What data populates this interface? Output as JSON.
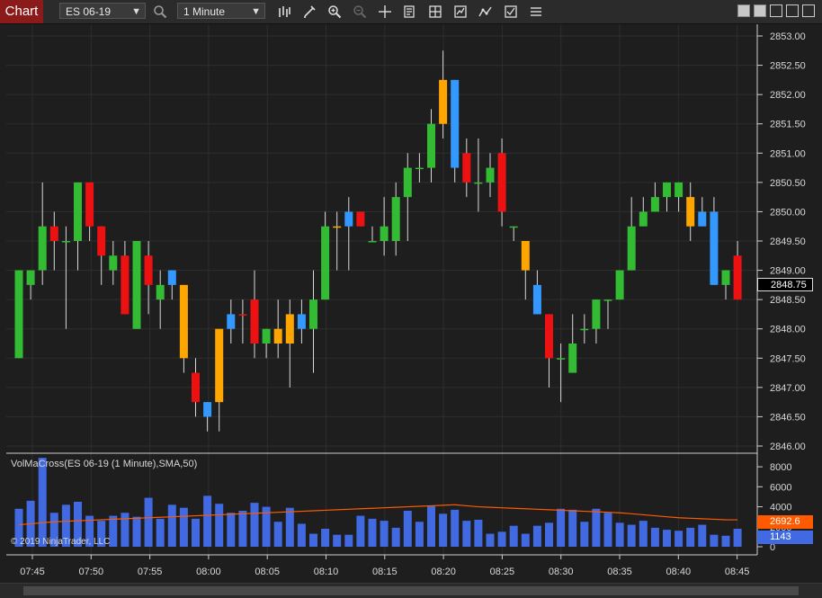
{
  "toolbar": {
    "tab_label": "Chart",
    "instrument": "ES 06-19",
    "interval": "1 Minute"
  },
  "icons": [
    "search-icon",
    "bar-type-icon",
    "pencil-icon",
    "zoom-in-icon",
    "zoom-out-icon",
    "crosshair-icon",
    "properties-icon",
    "indicators-icon",
    "strategies-icon",
    "drawing-tools-icon",
    "templates-icon",
    "menu-icon"
  ],
  "indicator": {
    "label": "VolMaCross(ES 06-19 (1 Minute),SMA,50)",
    "ma_value": "2692.6",
    "volume_value": "1143",
    "ma_color": "#ff5a00",
    "volume_color": "#4169e1"
  },
  "copyright": "© 2019 NinjaTrader, LLC",
  "price_axis": {
    "ticks": [
      "2853.00",
      "2852.50",
      "2852.00",
      "2851.50",
      "2851.00",
      "2850.50",
      "2850.00",
      "2849.50",
      "2849.00",
      "2848.50",
      "2848.00",
      "2847.50",
      "2847.00",
      "2846.50",
      "2846.00"
    ],
    "last_price": "2848.75"
  },
  "volume_axis": {
    "ticks": [
      "8000",
      "6000",
      "4000",
      "2000",
      "0"
    ]
  },
  "time_axis": {
    "ticks": [
      "07:45",
      "07:50",
      "07:55",
      "08:00",
      "08:05",
      "08:10",
      "08:15",
      "08:20",
      "08:25",
      "08:30",
      "08:35",
      "08:40",
      "08:45"
    ]
  },
  "colors": {
    "up": "#33bb33",
    "down": "#ee1111",
    "orange": "#ffa500",
    "blue": "#3399ff",
    "volume_bar": "#4169e1"
  },
  "chart_data": {
    "type": "candlestick",
    "instrument": "ES 06-19",
    "interval": "1 Minute",
    "x": [
      "07:44",
      "07:45",
      "07:46",
      "07:47",
      "07:48",
      "07:49",
      "07:50",
      "07:51",
      "07:52",
      "07:53",
      "07:54",
      "07:55",
      "07:56",
      "07:57",
      "07:58",
      "07:59",
      "08:00",
      "08:01",
      "08:02",
      "08:03",
      "08:04",
      "08:05",
      "08:06",
      "08:07",
      "08:08",
      "08:09",
      "08:10",
      "08:11",
      "08:12",
      "08:13",
      "08:14",
      "08:15",
      "08:16",
      "08:17",
      "08:18",
      "08:19",
      "08:20",
      "08:21",
      "08:22",
      "08:23",
      "08:24",
      "08:25",
      "08:26",
      "08:27",
      "08:28",
      "08:29",
      "08:30",
      "08:31",
      "08:32",
      "08:33",
      "08:34",
      "08:35",
      "08:36",
      "08:37",
      "08:38",
      "08:39",
      "08:40",
      "08:41",
      "08:42",
      "08:43",
      "08:44",
      "08:45"
    ],
    "candles": [
      {
        "o": 2847.5,
        "h": 2849.0,
        "l": 2847.5,
        "c": 2849.0,
        "color": "up"
      },
      {
        "o": 2848.75,
        "h": 2849.0,
        "l": 2848.5,
        "c": 2849.0,
        "color": "up"
      },
      {
        "o": 2849.0,
        "h": 2850.5,
        "l": 2848.75,
        "c": 2849.75,
        "color": "up"
      },
      {
        "o": 2849.75,
        "h": 2850.0,
        "l": 2849.0,
        "c": 2849.5,
        "color": "down"
      },
      {
        "o": 2849.5,
        "h": 2849.75,
        "l": 2848.0,
        "c": 2849.5,
        "color": "up"
      },
      {
        "o": 2849.5,
        "h": 2850.5,
        "l": 2849.0,
        "c": 2850.5,
        "color": "up"
      },
      {
        "o": 2850.5,
        "h": 2850.5,
        "l": 2849.5,
        "c": 2849.75,
        "color": "down"
      },
      {
        "o": 2849.75,
        "h": 2849.75,
        "l": 2848.75,
        "c": 2849.25,
        "color": "down"
      },
      {
        "o": 2849.0,
        "h": 2849.5,
        "l": 2848.75,
        "c": 2849.25,
        "color": "up"
      },
      {
        "o": 2849.25,
        "h": 2849.5,
        "l": 2848.25,
        "c": 2848.25,
        "color": "down"
      },
      {
        "o": 2848.0,
        "h": 2849.5,
        "l": 2848.0,
        "c": 2849.5,
        "color": "up"
      },
      {
        "o": 2849.25,
        "h": 2849.5,
        "l": 2848.25,
        "c": 2848.75,
        "color": "down"
      },
      {
        "o": 2848.5,
        "h": 2849.0,
        "l": 2848.0,
        "c": 2848.75,
        "color": "up"
      },
      {
        "o": 2848.75,
        "h": 2849.0,
        "l": 2848.5,
        "c": 2849.0,
        "color": "blue"
      },
      {
        "o": 2848.75,
        "h": 2848.75,
        "l": 2847.25,
        "c": 2847.5,
        "color": "orange"
      },
      {
        "o": 2847.25,
        "h": 2847.5,
        "l": 2846.5,
        "c": 2846.75,
        "color": "down"
      },
      {
        "o": 2846.75,
        "h": 2846.75,
        "l": 2846.25,
        "c": 2846.5,
        "color": "blue"
      },
      {
        "o": 2846.75,
        "h": 2848.0,
        "l": 2846.25,
        "c": 2848.0,
        "color": "orange"
      },
      {
        "o": 2848.0,
        "h": 2848.5,
        "l": 2847.75,
        "c": 2848.25,
        "color": "blue"
      },
      {
        "o": 2848.25,
        "h": 2848.5,
        "l": 2847.75,
        "c": 2848.25,
        "color": "down"
      },
      {
        "o": 2848.5,
        "h": 2849.0,
        "l": 2847.5,
        "c": 2847.75,
        "color": "down"
      },
      {
        "o": 2847.75,
        "h": 2848.0,
        "l": 2847.5,
        "c": 2848.0,
        "color": "up"
      },
      {
        "o": 2848.0,
        "h": 2848.5,
        "l": 2847.5,
        "c": 2847.75,
        "color": "orange"
      },
      {
        "o": 2847.75,
        "h": 2848.5,
        "l": 2847.0,
        "c": 2848.25,
        "color": "orange"
      },
      {
        "o": 2848.25,
        "h": 2848.5,
        "l": 2847.75,
        "c": 2848.0,
        "color": "blue"
      },
      {
        "o": 2848.0,
        "h": 2849.0,
        "l": 2847.25,
        "c": 2848.5,
        "color": "up"
      },
      {
        "o": 2848.5,
        "h": 2850.0,
        "l": 2848.5,
        "c": 2849.75,
        "color": "up"
      },
      {
        "o": 2849.75,
        "h": 2850.0,
        "l": 2849.0,
        "c": 2849.75,
        "color": "orange"
      },
      {
        "o": 2849.75,
        "h": 2850.25,
        "l": 2849.0,
        "c": 2850.0,
        "color": "blue"
      },
      {
        "o": 2850.0,
        "h": 2850.0,
        "l": 2849.75,
        "c": 2849.75,
        "color": "down"
      },
      {
        "o": 2849.5,
        "h": 2849.75,
        "l": 2849.5,
        "c": 2849.5,
        "color": "up"
      },
      {
        "o": 2849.5,
        "h": 2850.25,
        "l": 2849.25,
        "c": 2849.75,
        "color": "up"
      },
      {
        "o": 2849.5,
        "h": 2850.5,
        "l": 2849.25,
        "c": 2850.25,
        "color": "up"
      },
      {
        "o": 2850.25,
        "h": 2851.0,
        "l": 2849.5,
        "c": 2850.75,
        "color": "up"
      },
      {
        "o": 2850.75,
        "h": 2851.0,
        "l": 2850.5,
        "c": 2850.75,
        "color": "up"
      },
      {
        "o": 2850.75,
        "h": 2851.75,
        "l": 2850.5,
        "c": 2851.5,
        "color": "up"
      },
      {
        "o": 2851.5,
        "h": 2852.75,
        "l": 2851.25,
        "c": 2852.25,
        "color": "orange"
      },
      {
        "o": 2852.25,
        "h": 2852.25,
        "l": 2850.5,
        "c": 2850.75,
        "color": "blue"
      },
      {
        "o": 2851.0,
        "h": 2851.25,
        "l": 2850.25,
        "c": 2850.5,
        "color": "down"
      },
      {
        "o": 2850.5,
        "h": 2851.25,
        "l": 2850.0,
        "c": 2850.5,
        "color": "up"
      },
      {
        "o": 2850.5,
        "h": 2851.0,
        "l": 2850.25,
        "c": 2850.75,
        "color": "up"
      },
      {
        "o": 2851.0,
        "h": 2851.25,
        "l": 2849.75,
        "c": 2850.0,
        "color": "down"
      },
      {
        "o": 2849.75,
        "h": 2849.75,
        "l": 2849.5,
        "c": 2849.75,
        "color": "up"
      },
      {
        "o": 2849.5,
        "h": 2849.5,
        "l": 2848.5,
        "c": 2849.0,
        "color": "orange"
      },
      {
        "o": 2848.75,
        "h": 2849.0,
        "l": 2848.25,
        "c": 2848.25,
        "color": "blue"
      },
      {
        "o": 2848.25,
        "h": 2848.25,
        "l": 2847.0,
        "c": 2847.5,
        "color": "down"
      },
      {
        "o": 2847.5,
        "h": 2847.75,
        "l": 2846.75,
        "c": 2847.5,
        "color": "up"
      },
      {
        "o": 2847.25,
        "h": 2848.25,
        "l": 2847.25,
        "c": 2847.75,
        "color": "up"
      },
      {
        "o": 2848.0,
        "h": 2848.25,
        "l": 2847.75,
        "c": 2848.0,
        "color": "up"
      },
      {
        "o": 2848.0,
        "h": 2848.5,
        "l": 2847.75,
        "c": 2848.5,
        "color": "up"
      },
      {
        "o": 2848.5,
        "h": 2848.5,
        "l": 2848.0,
        "c": 2848.5,
        "color": "up"
      },
      {
        "o": 2848.5,
        "h": 2849.0,
        "l": 2848.5,
        "c": 2849.0,
        "color": "up"
      },
      {
        "o": 2849.0,
        "h": 2850.25,
        "l": 2849.0,
        "c": 2849.75,
        "color": "up"
      },
      {
        "o": 2849.75,
        "h": 2850.25,
        "l": 2849.75,
        "c": 2850.0,
        "color": "up"
      },
      {
        "o": 2850.0,
        "h": 2850.5,
        "l": 2850.0,
        "c": 2850.25,
        "color": "up"
      },
      {
        "o": 2850.25,
        "h": 2850.5,
        "l": 2850.0,
        "c": 2850.5,
        "color": "up"
      },
      {
        "o": 2850.5,
        "h": 2850.5,
        "l": 2850.0,
        "c": 2850.25,
        "color": "up"
      },
      {
        "o": 2850.25,
        "h": 2850.5,
        "l": 2849.5,
        "c": 2849.75,
        "color": "orange"
      },
      {
        "o": 2849.75,
        "h": 2850.25,
        "l": 2849.75,
        "c": 2850.0,
        "color": "blue"
      },
      {
        "o": 2850.0,
        "h": 2850.25,
        "l": 2848.75,
        "c": 2848.75,
        "color": "blue"
      },
      {
        "o": 2848.75,
        "h": 2849.0,
        "l": 2848.5,
        "c": 2849.0,
        "color": "up"
      },
      {
        "o": 2849.25,
        "h": 2849.5,
        "l": 2848.5,
        "c": 2848.5,
        "color": "down"
      }
    ],
    "volume": [
      3800,
      4600,
      8900,
      3400,
      4200,
      4500,
      3100,
      2600,
      3100,
      3400,
      3000,
      4900,
      2800,
      4200,
      3900,
      2800,
      5100,
      4300,
      3400,
      3600,
      4400,
      4000,
      2500,
      3900,
      2300,
      1300,
      1800,
      1200,
      1200,
      3100,
      2800,
      2600,
      1900,
      3600,
      2500,
      4100,
      3300,
      3700,
      2600,
      2700,
      1300,
      1500,
      2100,
      1300,
      2100,
      2400,
      3800,
      3700,
      2500,
      3800,
      3400,
      2400,
      2200,
      2600,
      1900,
      1700,
      1600,
      1900,
      2200,
      1200,
      1100,
      1800
    ],
    "ma": [
      2200,
      2300,
      2400,
      2500,
      2550,
      2600,
      2650,
      2700,
      2750,
      2800,
      2850,
      2900,
      2950,
      3000,
      3050,
      3100,
      3150,
      3200,
      3250,
      3300,
      3350,
      3400,
      3450,
      3500,
      3550,
      3600,
      3650,
      3700,
      3750,
      3800,
      3850,
      3900,
      3950,
      4000,
      4050,
      4100,
      4150,
      4200,
      4100,
      4000,
      3950,
      3900,
      3850,
      3800,
      3750,
      3700,
      3650,
      3600,
      3550,
      3500,
      3450,
      3400,
      3300,
      3200,
      3100,
      3000,
      2900,
      2850,
      2800,
      2750,
      2700,
      2692.6
    ],
    "ylim": [
      2846.0,
      2853.0
    ],
    "volume_ylim": [
      0,
      9000
    ]
  }
}
